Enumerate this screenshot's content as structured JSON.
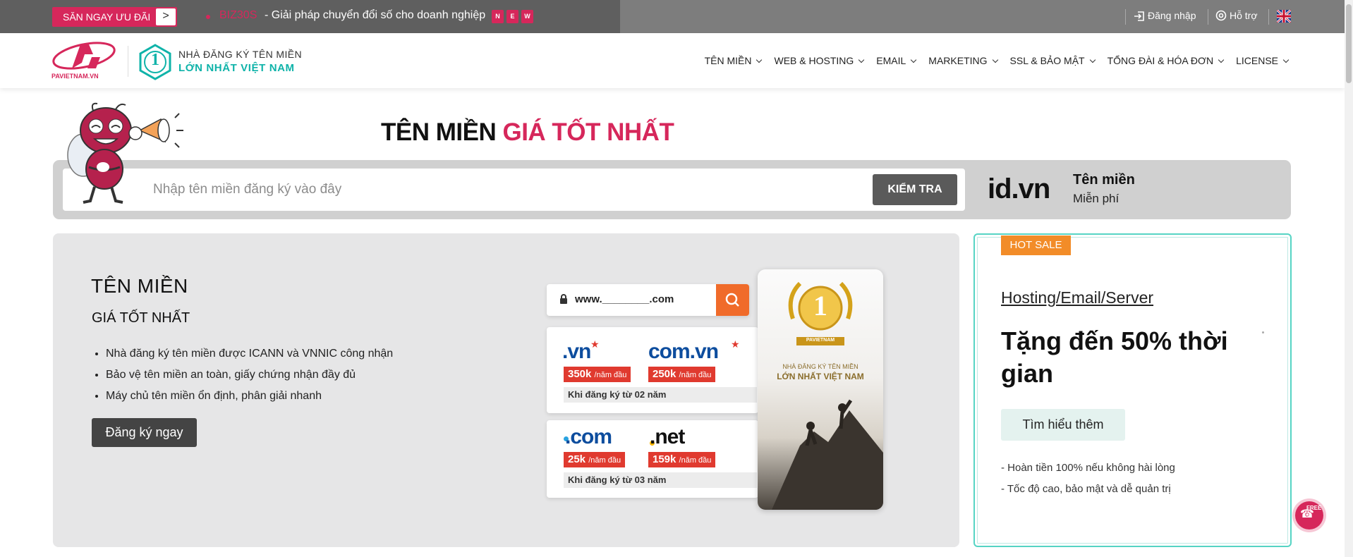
{
  "topbar": {
    "promo_button": "SĂN NGAY ƯU ĐÃI",
    "promo_arrow": ">",
    "news_code": "BIZ30S",
    "news_text": "- Giải pháp chuyển đổi số cho doanh nghiệp",
    "news_badges": [
      "N",
      "E",
      "W"
    ],
    "login": "Đăng nhập",
    "support": "Hỗ trợ",
    "language_flag": "uk-flag-icon"
  },
  "header": {
    "brand_name": "PAVIETNAM.VN",
    "slogan_line1": "NHÀ ĐĂNG KÝ TÊN MIỀN",
    "slogan_line2": "LỚN NHẤT VIỆT NAM",
    "rank_badge": "1",
    "nav": [
      "TÊN MIỀN",
      "WEB & HOSTING",
      "EMAIL",
      "MARKETING",
      "SSL & BẢO MẬT",
      "TỔNG ĐÀI & HÓA ĐƠN",
      "LICENSE"
    ]
  },
  "hero": {
    "title_part1": "TÊN MIỀN",
    "title_part2": "GIÁ TỐT NHẤT",
    "search_placeholder": "Nhập tên miền đăng ký vào đây",
    "search_value": "",
    "check_button": "KIỂM TRA",
    "promo_domain": "id.vn",
    "promo_line1": "Tên miền",
    "promo_line2": "Miễn phí"
  },
  "main_card": {
    "title": "TÊN MIỀN",
    "subtitle": "GIÁ TỐT NHẤT",
    "features": [
      "Nhà đăng ký tên miền được ICANN và VNNIC công nhận",
      "Bảo vệ tên miền an toàn, giấy chứng nhận đầy đủ",
      "Máy chủ tên miền ổn định, phân giải nhanh"
    ],
    "register_button": "Đăng ký ngay",
    "graphic": {
      "www_text": "www.________.com",
      "group1": {
        "tlds": [
          {
            "name": ".vn",
            "price": "350k",
            "unit": "/năm đầu"
          },
          {
            "name": "com.vn",
            "price": "250k",
            "unit": "/năm đầu"
          }
        ],
        "note": "Khi đăng ký từ 02 năm"
      },
      "group2": {
        "tlds": [
          {
            "name": ".com",
            "price": "25k",
            "unit": "/năm đầu"
          },
          {
            "name": ".net",
            "price": "159k",
            "unit": "/năm đầu"
          }
        ],
        "note": "Khi đăng ký từ 03 năm"
      },
      "photo_badge_text": "1",
      "photo_badge_brand": "PAVIETNAM",
      "photo_line1": "NHÀ ĐĂNG KÝ TÊN MIỀN",
      "photo_line2": "LỚN NHẤT VIỆT NAM"
    }
  },
  "side_card": {
    "badge": "HOT SALE",
    "link": "Hosting/Email/Server",
    "headline": "Tặng đến 50% thời gian",
    "button": "Tìm hiểu thêm",
    "notes": [
      "- Hoàn tiền 100% nếu không hài lòng",
      "- Tốc độ cao, bảo mật và dễ quản trị"
    ]
  },
  "floating": {
    "free_call": "FREE"
  },
  "colors": {
    "brand_pink": "#d6275b",
    "teal": "#0fb3a9",
    "orange": "#f06b2a",
    "hot_sale": "#f28c28"
  }
}
